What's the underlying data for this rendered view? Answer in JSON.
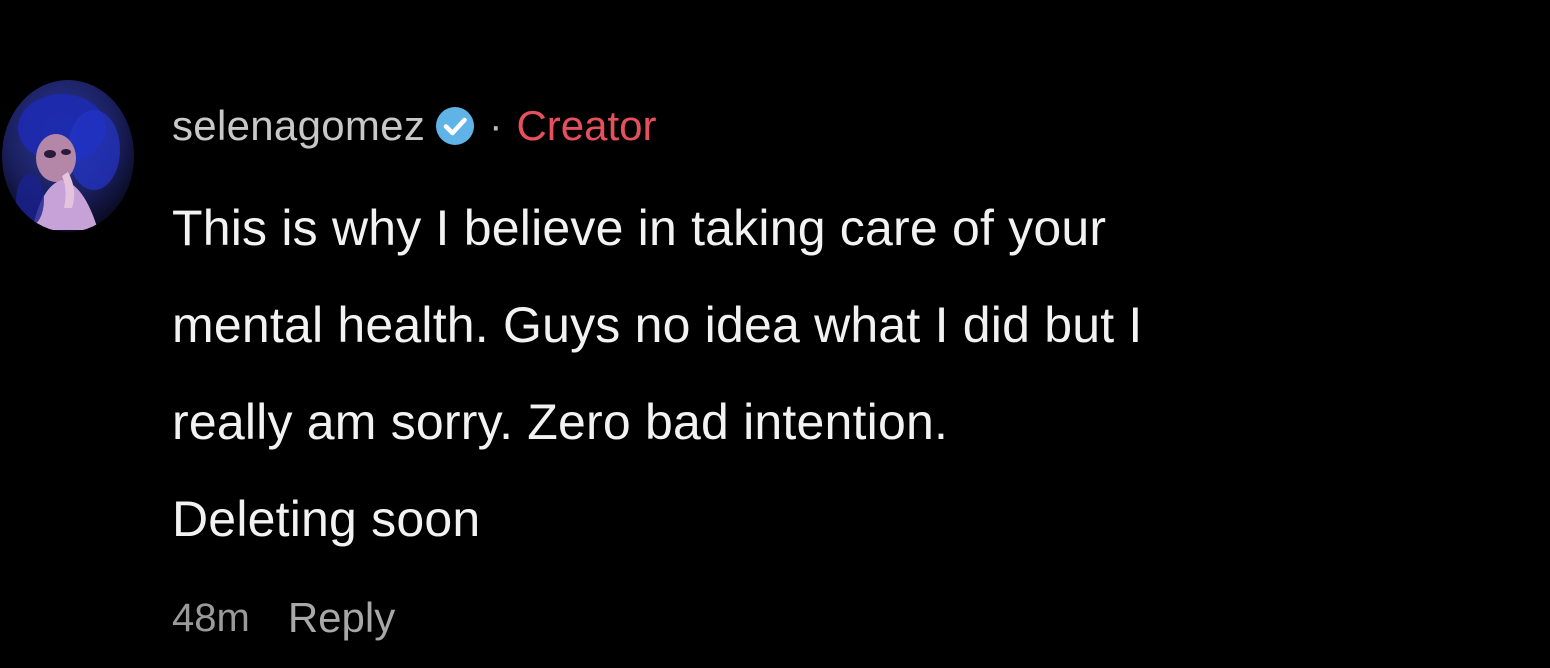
{
  "comment": {
    "username": "selenagomez",
    "verified_icon": "verified-badge-icon",
    "separator": "·",
    "badge": "Creator",
    "text_lines": [
      "This is why I believe in taking care of your",
      "mental health. Guys no idea what I did but I",
      "really am sorry. Zero bad intention.",
      "Deleting soon"
    ],
    "timestamp": "48m",
    "reply_label": "Reply"
  },
  "colors": {
    "background": "#000000",
    "username": "#c8c8c8",
    "badge": "#e5505c",
    "verified": "#5fb3e6",
    "body_text": "#f2f2f2",
    "meta_text": "#9a9a9a"
  }
}
